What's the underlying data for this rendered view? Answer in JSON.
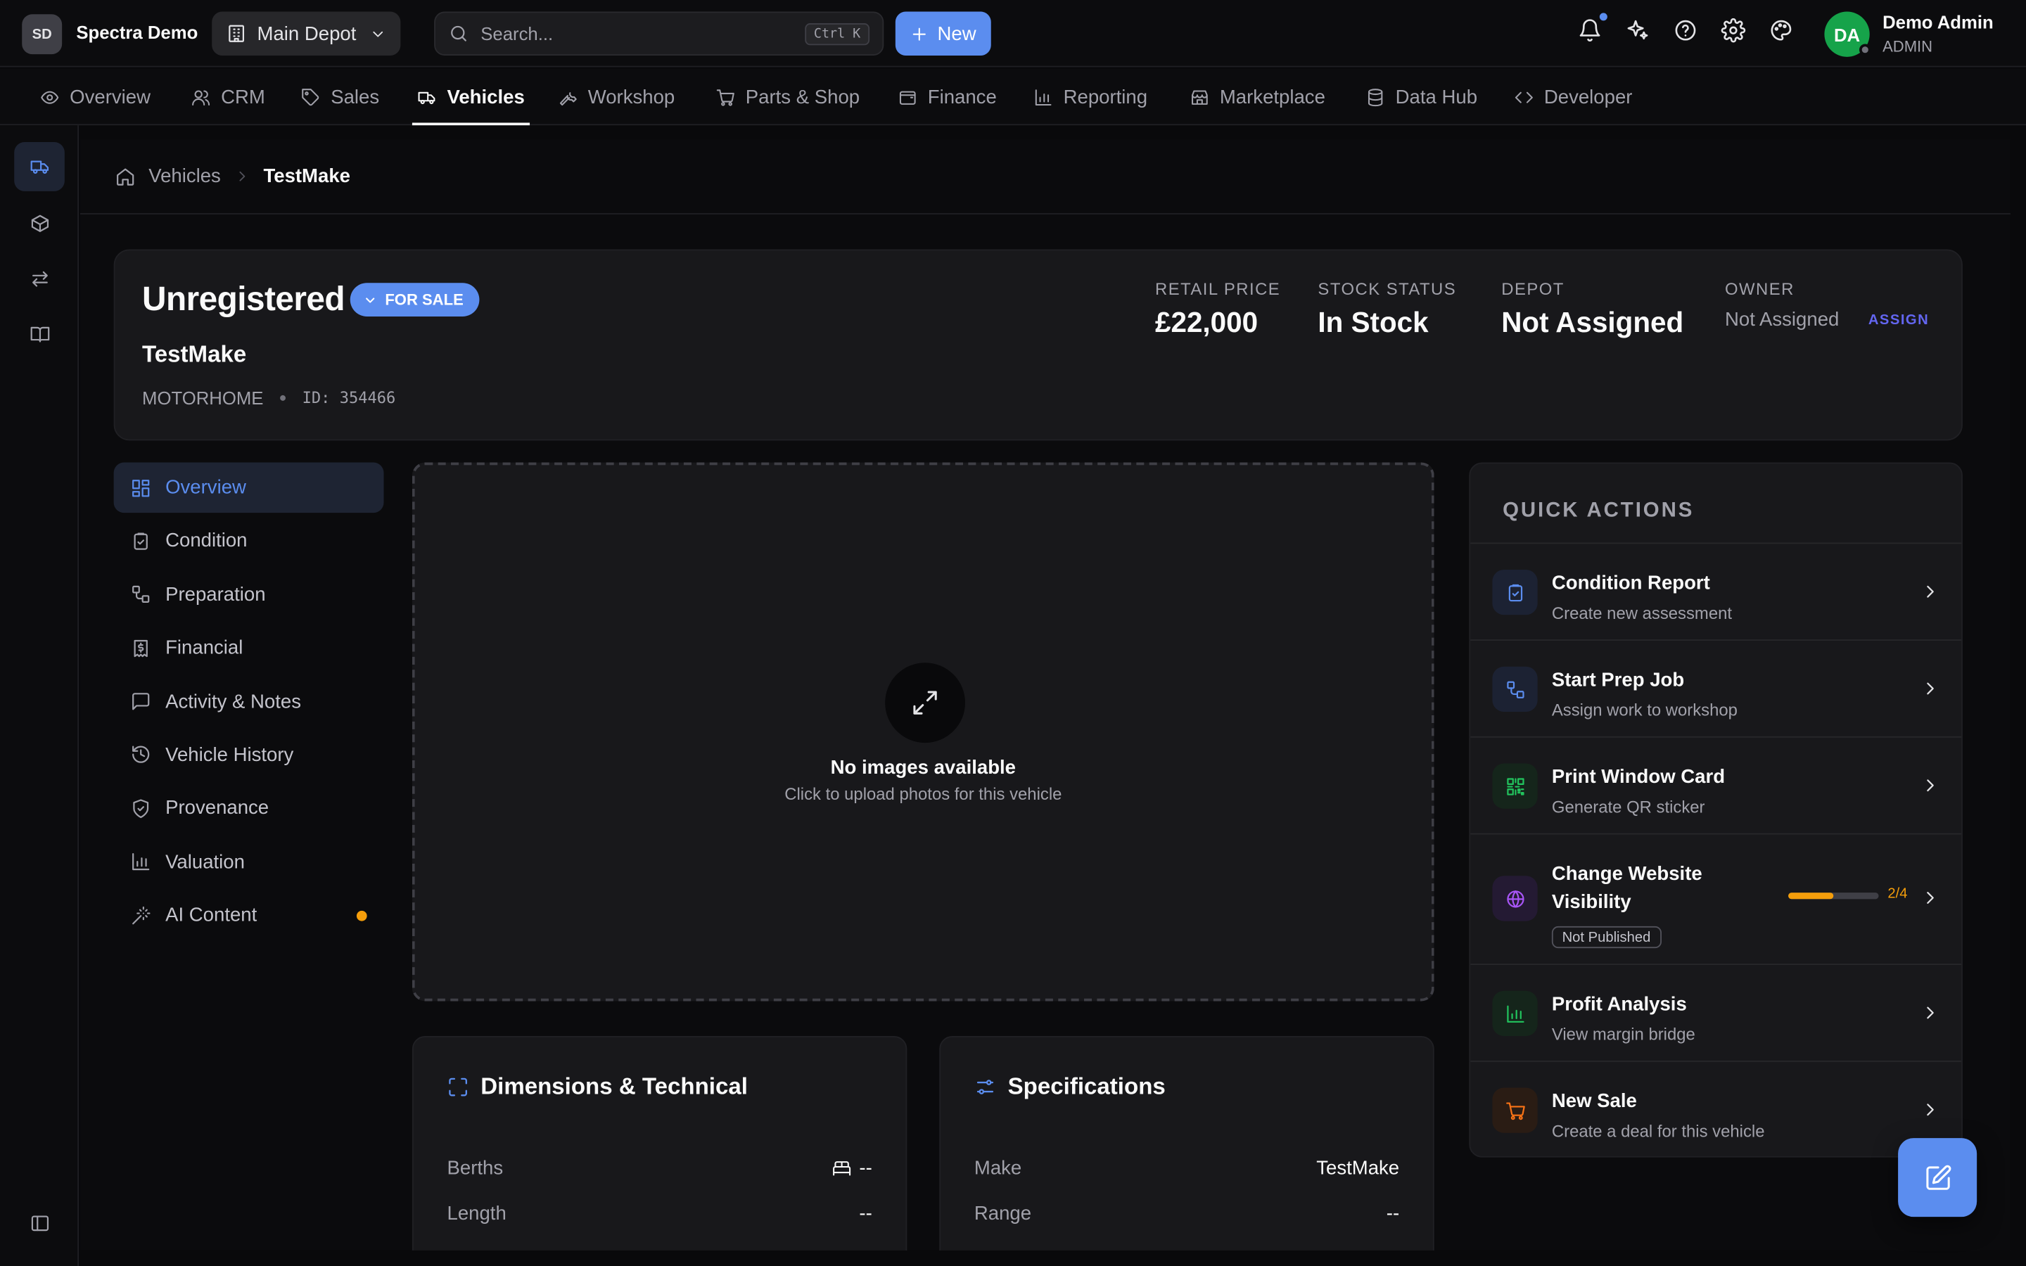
{
  "brand": {
    "initials": "SD",
    "name": "Spectra Demo"
  },
  "depot_selector": {
    "label": "Main Depot"
  },
  "search": {
    "placeholder": "Search...",
    "shortcut": "Ctrl K"
  },
  "new_button": {
    "label": "New"
  },
  "user": {
    "initials": "DA",
    "name": "Demo Admin",
    "role": "ADMIN"
  },
  "top_icons": [
    "bell-icon",
    "sparkles-icon",
    "help-icon",
    "gear-icon",
    "palette-icon"
  ],
  "nav": {
    "tabs": [
      {
        "label": "Overview",
        "icon": "eye-icon"
      },
      {
        "label": "CRM",
        "icon": "users-icon"
      },
      {
        "label": "Sales",
        "icon": "tag-icon"
      },
      {
        "label": "Vehicles",
        "icon": "truck-icon",
        "active": true
      },
      {
        "label": "Workshop",
        "icon": "wrench-icon"
      },
      {
        "label": "Parts & Shop",
        "icon": "cart-icon"
      },
      {
        "label": "Finance",
        "icon": "wallet-icon"
      },
      {
        "label": "Reporting",
        "icon": "chart-icon"
      },
      {
        "label": "Marketplace",
        "icon": "store-icon"
      },
      {
        "label": "Data Hub",
        "icon": "database-icon"
      },
      {
        "label": "Developer",
        "icon": "code-icon"
      }
    ]
  },
  "rail": [
    "truck-icon",
    "box-icon",
    "arrows-icon",
    "book-icon",
    "sidebar-toggle-icon"
  ],
  "breadcrumb": {
    "root": "Vehicles",
    "current": "TestMake"
  },
  "vehicle": {
    "title": "Unregistered",
    "status_badge": "FOR SALE",
    "make": "TestMake",
    "type": "MOTORHOME",
    "id_label": "ID: 354466"
  },
  "stats": {
    "retail_price": {
      "label": "RETAIL PRICE",
      "value": "£22,000"
    },
    "stock_status": {
      "label": "STOCK STATUS",
      "value": "In Stock"
    },
    "depot": {
      "label": "DEPOT",
      "value": "Not Assigned"
    },
    "owner": {
      "label": "OWNER",
      "value": "Not Assigned",
      "action": "ASSIGN"
    }
  },
  "subnav": [
    {
      "label": "Overview",
      "icon": "grid-icon",
      "active": true
    },
    {
      "label": "Condition",
      "icon": "clipboard-icon"
    },
    {
      "label": "Preparation",
      "icon": "workflow-icon"
    },
    {
      "label": "Financial",
      "icon": "receipt-icon"
    },
    {
      "label": "Activity & Notes",
      "icon": "message-icon"
    },
    {
      "label": "Vehicle History",
      "icon": "history-icon"
    },
    {
      "label": "Provenance",
      "icon": "shield-icon"
    },
    {
      "label": "Valuation",
      "icon": "bar-chart-icon"
    },
    {
      "label": "AI Content",
      "icon": "wand-icon",
      "dot": true
    }
  ],
  "images": {
    "title": "No images available",
    "subtitle": "Click to upload photos for this vehicle"
  },
  "dimensions_card": {
    "title": "Dimensions & Technical",
    "rows": [
      {
        "key": "Berths",
        "value": "--"
      },
      {
        "key": "Length",
        "value": "--"
      }
    ]
  },
  "specs_card": {
    "title": "Specifications",
    "rows": [
      {
        "key": "Make",
        "value": "TestMake"
      },
      {
        "key": "Range",
        "value": "--"
      }
    ]
  },
  "quick_actions": {
    "title": "QUICK ACTIONS",
    "items": [
      {
        "name": "Condition Report",
        "sub": "Create new assessment",
        "icon": "clipboard-check-icon",
        "color": "#5b8def"
      },
      {
        "name": "Start Prep Job",
        "sub": "Assign work to workshop",
        "icon": "workflow-icon",
        "color": "#5b8def"
      },
      {
        "name": "Print Window Card",
        "sub": "Generate QR sticker",
        "icon": "qr-icon",
        "color": "#22c55e"
      },
      {
        "name": "Change Website Visibility",
        "badge": "Not Published",
        "progress": 0.5,
        "progress_label": "2/4",
        "icon": "globe-icon",
        "color": "#a855f7"
      },
      {
        "name": "Profit Analysis",
        "sub": "View margin bridge",
        "icon": "bar-chart-icon",
        "color": "#22c55e"
      },
      {
        "name": "New Sale",
        "sub": "Create a deal for this vehicle",
        "icon": "cart-icon",
        "color": "#f97316"
      }
    ]
  },
  "fab": {
    "icon": "edit-icon"
  },
  "colors": {
    "accent": "#5b8def",
    "background": "#09090b",
    "panel": "#18181b",
    "warning": "#f59e0b"
  }
}
